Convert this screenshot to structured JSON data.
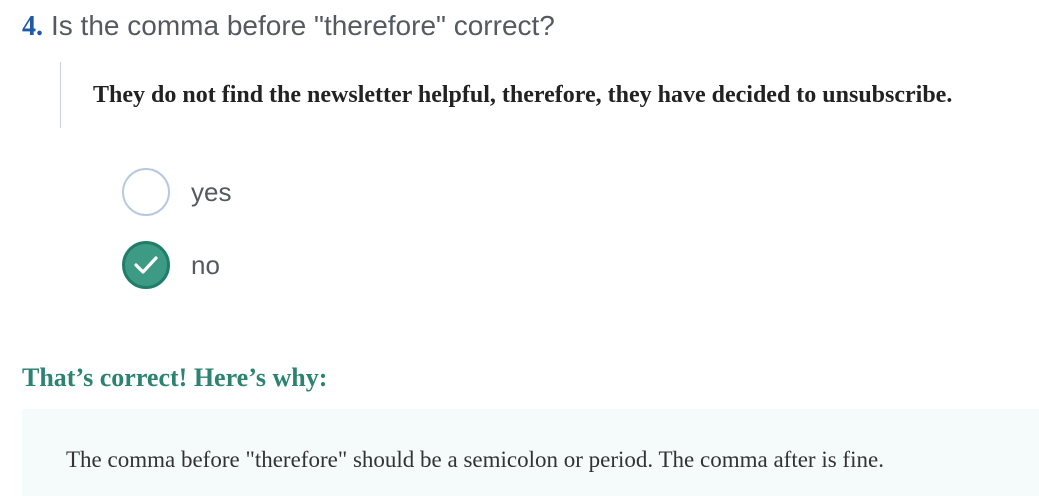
{
  "question": {
    "number": "4.",
    "text": "Is the comma before \"therefore\" correct?"
  },
  "sentence": "They do not find the newsletter helpful, therefore, they have decided to unsubscribe.",
  "options": [
    {
      "label": "yes",
      "selected": false
    },
    {
      "label": "no",
      "selected": true
    }
  ],
  "feedback": {
    "title": "That’s correct! Here’s why:",
    "explanation": "The comma before \"therefore\" should be a semicolon or period. The comma after is fine."
  },
  "colors": {
    "question_number": "#1f5aa6",
    "selected_radio": "#3d9a85",
    "feedback_title": "#2d8371",
    "explanation_background": "#f4fbfa"
  }
}
